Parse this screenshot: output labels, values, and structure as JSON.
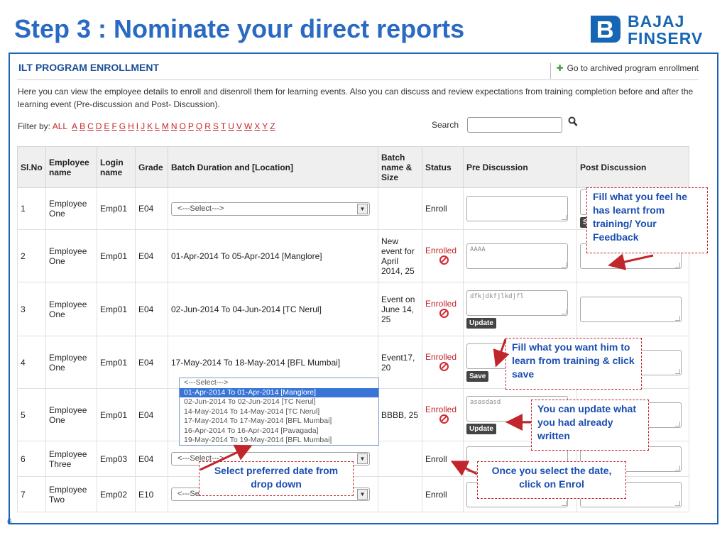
{
  "slide": {
    "title": "Step 3 : Nominate your direct reports",
    "logo_line1": "BAJAJ",
    "logo_line2": "FINSERV",
    "page_number": "6",
    "colors": {
      "title": "#2a6ac3",
      "frame": "#1a63b8",
      "callout_text": "#1a4db0",
      "arrow": "#c0262c"
    }
  },
  "app": {
    "title": "ILT PROGRAM ENROLLMENT",
    "archived_link": "Go to archived program enrollment",
    "archived_icon": "plus-icon",
    "description": "Here you can view the employee details to enroll and disenroll them for learning events. Also you can discuss and review expectations from training completion before and after the learning event (Pre-discussion and Post- Discussion).",
    "filter_label": "Filter by:",
    "filter_all": "ALL",
    "filter_letters": [
      "A",
      "B",
      "C",
      "D",
      "E",
      "F",
      "G",
      "H",
      "I",
      "J",
      "K",
      "L",
      "M",
      "N",
      "O",
      "P",
      "Q",
      "R",
      "S",
      "T",
      "U",
      "V",
      "W",
      "X",
      "Y",
      "Z"
    ],
    "search_label": "Search",
    "search_value": ""
  },
  "table": {
    "headers": [
      "Sl.No",
      "Employee name",
      "Login name",
      "Grade",
      "Batch Duration and [Location]",
      "Batch name & Size",
      "Status",
      "Pre Discussion",
      "Post Discussion"
    ],
    "rows": [
      {
        "sl": "1",
        "name": "Employee One",
        "login": "Emp01",
        "grade": "E04",
        "batch": "<---Select--->",
        "batch_is_select": true,
        "batch_name": "",
        "status": "Enroll",
        "enrolled": false,
        "pre": "",
        "pre_button": "",
        "post": "",
        "post_button": "Save"
      },
      {
        "sl": "2",
        "name": "Employee One",
        "login": "Emp01",
        "grade": "E04",
        "batch": "01-Apr-2014 To 05-Apr-2014 [Manglore]",
        "batch_is_select": false,
        "batch_name": "New event for April 2014, 25",
        "status": "Enrolled",
        "enrolled": true,
        "pre": "AAAA",
        "pre_button": "",
        "post": "",
        "post_button": ""
      },
      {
        "sl": "3",
        "name": "Employee One",
        "login": "Emp01",
        "grade": "E04",
        "batch": "02-Jun-2014 To 04-Jun-2014 [TC Nerul]",
        "batch_is_select": false,
        "batch_name": "Event on June 14, 25",
        "status": "Enrolled",
        "enrolled": true,
        "pre": "dfkjdkfjlkdjfl",
        "pre_button": "Update",
        "post": "",
        "post_button": ""
      },
      {
        "sl": "4",
        "name": "Employee One",
        "login": "Emp01",
        "grade": "E04",
        "batch": "17-May-2014 To 18-May-2014 [BFL Mumbai]",
        "batch_is_select": false,
        "batch_name": "Event17, 20",
        "status": "Enrolled",
        "enrolled": true,
        "pre": "",
        "pre_button": "Save",
        "post": "",
        "post_button": ""
      },
      {
        "sl": "5",
        "name": "Employee One",
        "login": "Emp01",
        "grade": "E04",
        "batch": "",
        "batch_is_select": false,
        "batch_name": "BBBB, 25",
        "status": "Enrolled",
        "enrolled": true,
        "pre": "asasdasd",
        "pre_button": "Update",
        "post": "",
        "post_button": ""
      },
      {
        "sl": "6",
        "name": "Employee Three",
        "login": "Emp03",
        "grade": "E04",
        "batch": "<---Select--->",
        "batch_is_select": true,
        "batch_name": "",
        "status": "Enroll",
        "enrolled": false,
        "pre": "",
        "pre_button": "",
        "post": "",
        "post_button": ""
      },
      {
        "sl": "7",
        "name": "Employee Two",
        "login": "Emp02",
        "grade": "E10",
        "batch": "<---Select--->",
        "batch_is_select": true,
        "batch_name": "",
        "status": "Enroll",
        "enrolled": false,
        "pre": "",
        "pre_button": "",
        "post": "",
        "post_button": ""
      }
    ],
    "dropdown_options": [
      "<---Select--->",
      "01-Apr-2014 To 01-Apr-2014 [Manglore]",
      "02-Jun-2014 To 02-Jun-2014 [TC Nerul]",
      "14-May-2014 To 14-May-2014 [TC Nerul]",
      "17-May-2014 To 17-May-2014 [BFL Mumbai]",
      "16-Apr-2014 To 16-Apr-2014 [Pavagada]",
      "19-May-2014 To 19-May-2014 [BFL Mumbai]"
    ],
    "dropdown_selected": 1
  },
  "callouts": {
    "post_feedback": "Fill what you feel he has learnt from training/ Your Feedback",
    "pre_save": "Fill what you want him to learn from training & click save",
    "update": "You can update what you had already written",
    "select_date": "Select preferred date from drop down",
    "enroll": "Once you select the date, click on Enrol"
  }
}
